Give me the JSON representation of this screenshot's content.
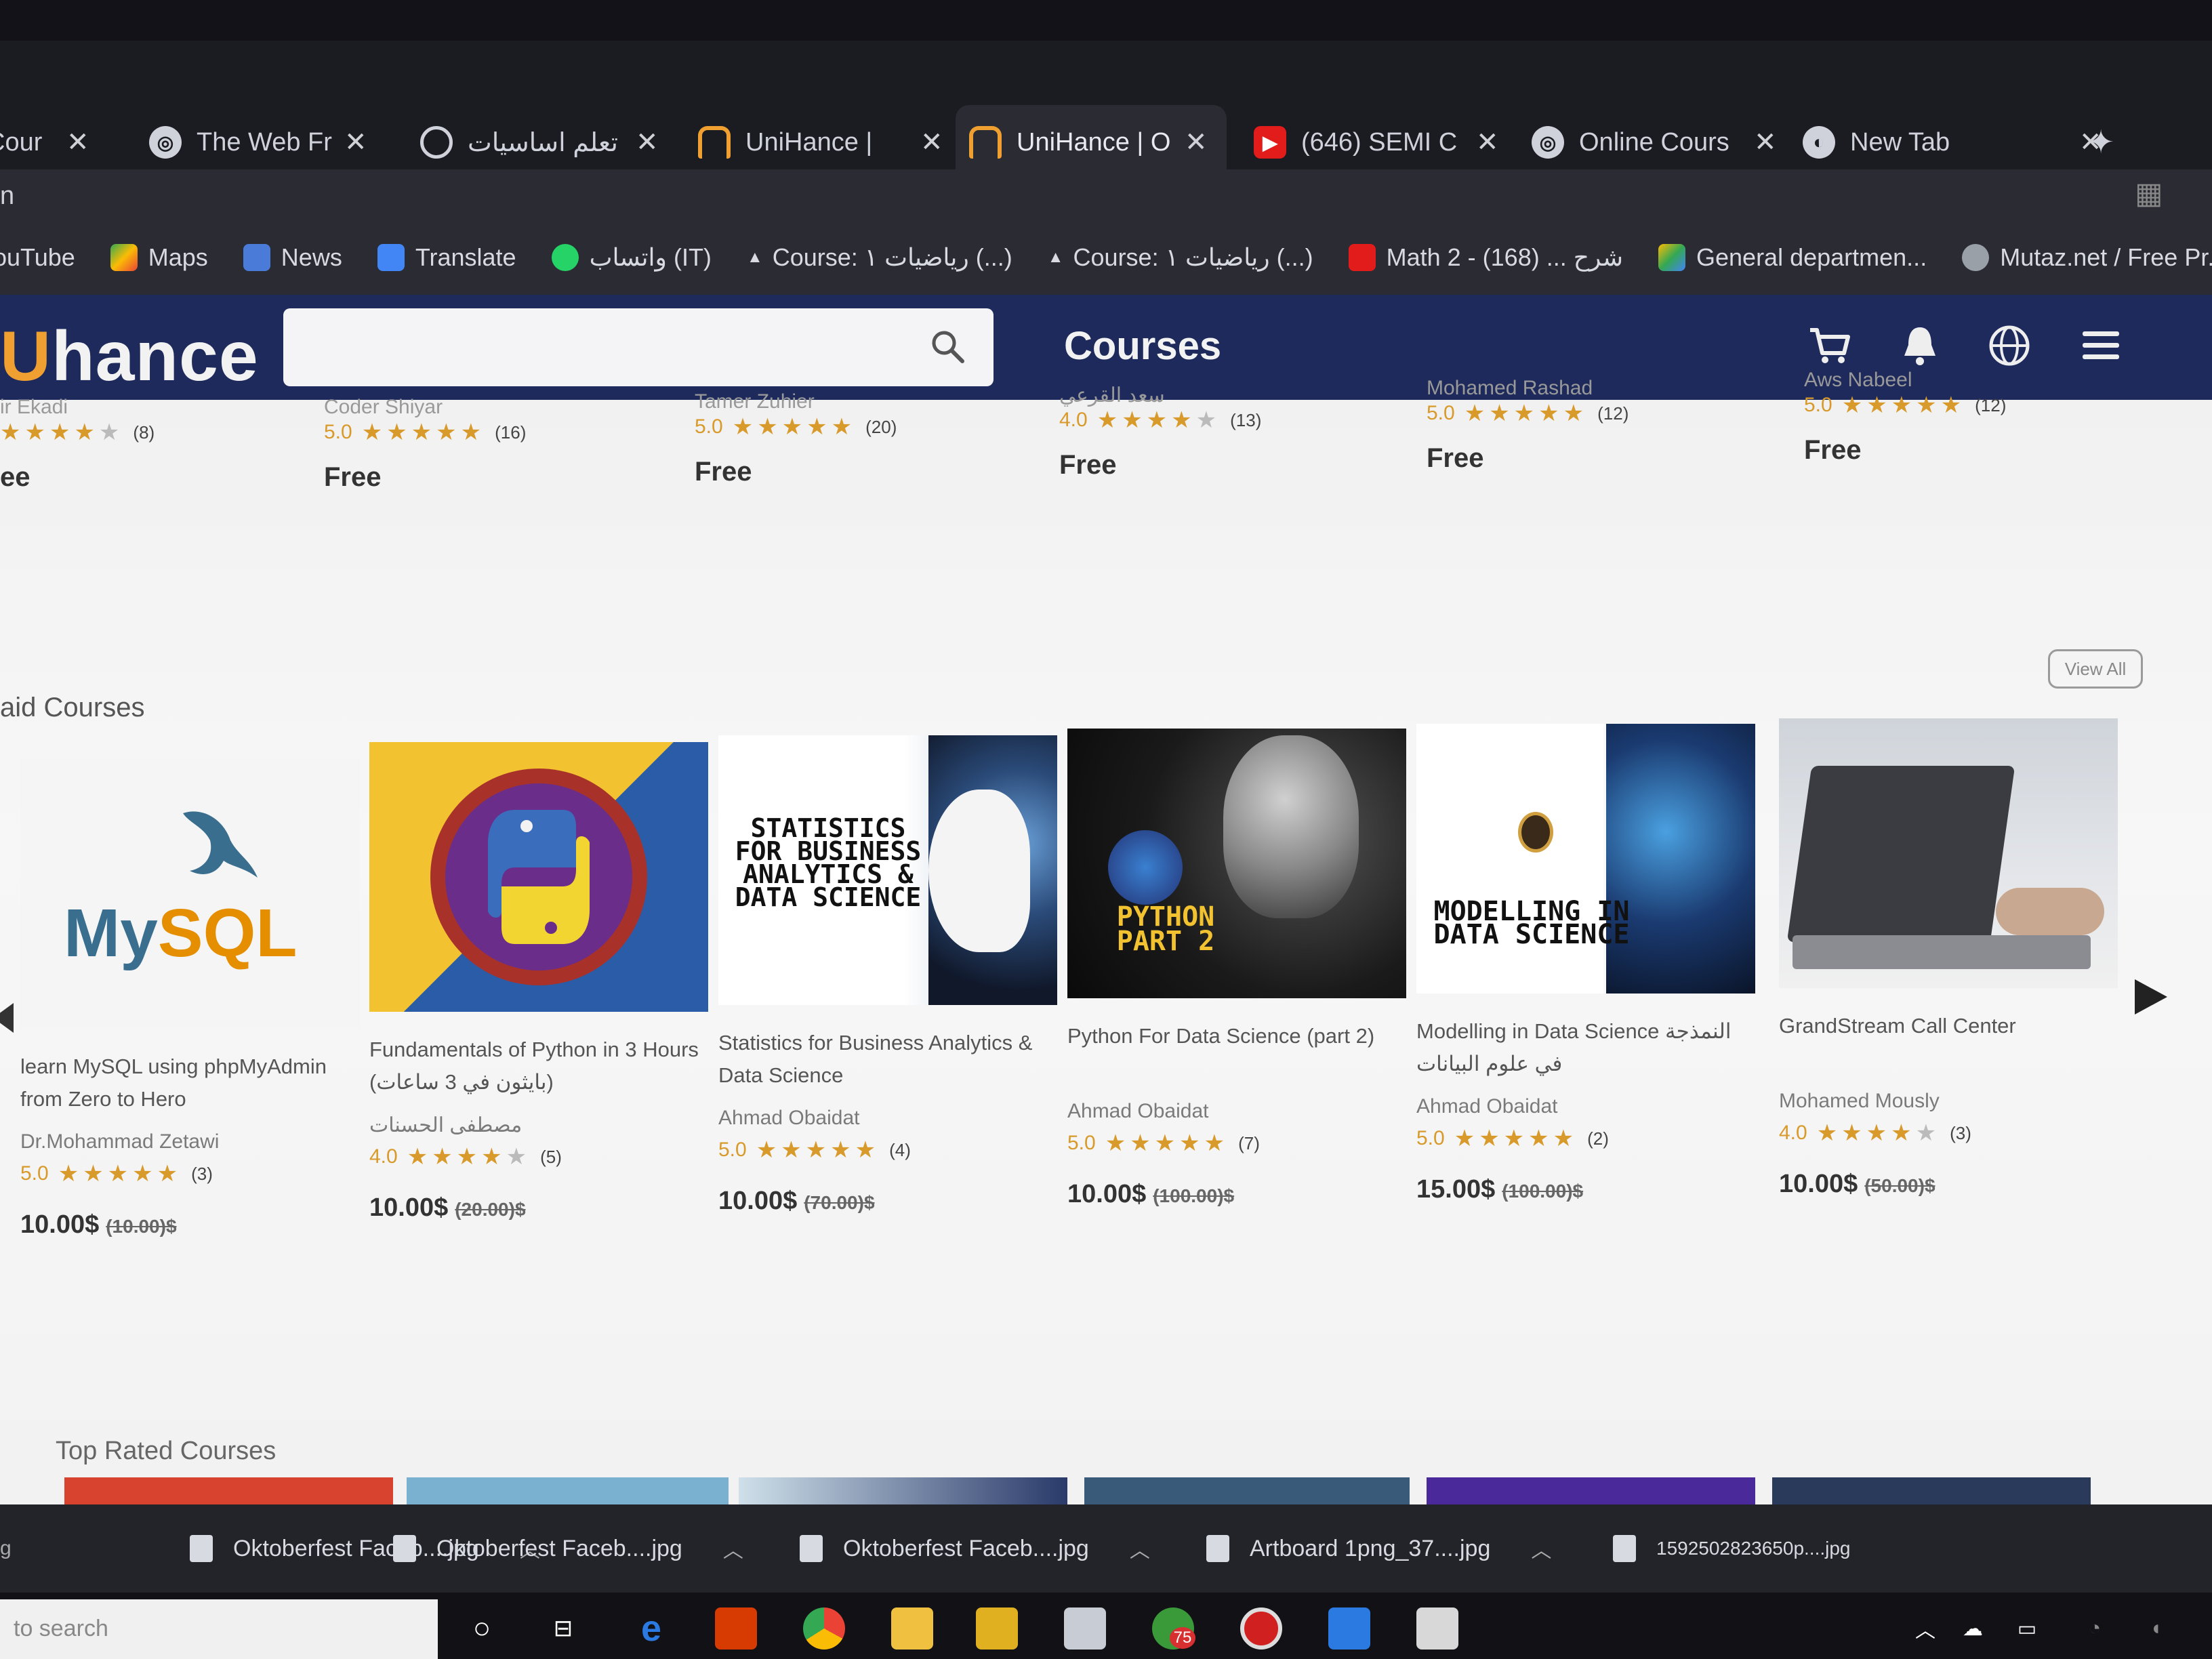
{
  "tabs": [
    {
      "title": "Cour",
      "icon": "unihance-icon"
    },
    {
      "title": "The Web Fro",
      "icon": "site-icon"
    },
    {
      "title": "تعلم اساسيات",
      "icon": "globe-icon"
    },
    {
      "title": "UniHance |",
      "icon": "unihance-icon"
    },
    {
      "title": "UniHance | O",
      "icon": "unihance-icon",
      "active": true
    },
    {
      "title": "(646) SEMI C",
      "icon": "youtube-icon"
    },
    {
      "title": "Online Cours",
      "icon": "site-icon"
    },
    {
      "title": "New Tab",
      "icon": "chrome-icon"
    }
  ],
  "address": {
    "text": "n"
  },
  "bookmarks": [
    {
      "label": "ouTube"
    },
    {
      "label": "Maps"
    },
    {
      "label": "News"
    },
    {
      "label": "Translate"
    },
    {
      "label": "واتساب (IT)"
    },
    {
      "label": "Course: رياضيات ١ (...)"
    },
    {
      "label": "Course: رياضيات ١ (...)"
    },
    {
      "label": "Math 2 - شرح ... (168)"
    },
    {
      "label": "General departmen..."
    },
    {
      "label": "Mutaz.net / Free Pr..."
    }
  ],
  "header": {
    "logo": "hance",
    "logo_prefix": "U",
    "nav_courses": "Courses",
    "search_placeholder": ""
  },
  "free_courses": [
    {
      "author": "ir Ekadi",
      "rating": "",
      "stars": 4,
      "count": "(8)",
      "price": "ee"
    },
    {
      "author": "Coder Shiyar",
      "rating": "5.0",
      "stars": 5,
      "count": "(16)",
      "price": "Free"
    },
    {
      "author": "Tamer Zuhier",
      "rating": "5.0",
      "stars": 5,
      "count": "(20)",
      "price": "Free"
    },
    {
      "author": "سعد القرعي",
      "rating": "4.0",
      "stars": 4,
      "count": "(13)",
      "price": "Free"
    },
    {
      "author": "Mohamed Rashad",
      "rating": "5.0",
      "stars": 5,
      "count": "(12)",
      "price": "Free"
    },
    {
      "author": "Aws Nabeel",
      "rating": "5.0",
      "stars": 5,
      "count": "(12)",
      "price": "Free"
    }
  ],
  "paid_section": {
    "title": "aid Courses",
    "view_all": "View All"
  },
  "paid_courses": [
    {
      "title": "learn MySQL using phpMyAdmin from Zero to Hero",
      "author": "Dr.Mohammad Zetawi",
      "rating": "5.0",
      "stars": 5,
      "count": "(3)",
      "price": "10.00$",
      "old_price": "(10.00)$",
      "thumb_text": "MySQL"
    },
    {
      "title": "Fundamentals of Python in 3 Hours (بايثون في 3 ساعات)",
      "author": "مصطفى الحسنات",
      "rating": "4.0",
      "stars": 4,
      "count": "(5)",
      "price": "10.00$",
      "old_price": "(20.00)$",
      "thumb_text": ""
    },
    {
      "title": "Statistics for Business Analytics & Data Science",
      "author": "Ahmad Obaidat",
      "rating": "5.0",
      "stars": 5,
      "count": "(4)",
      "price": "10.00$",
      "old_price": "(70.00)$",
      "thumb_text": "STATISTICS FOR BUSINESS ANALYTICS & DATA SCIENCE"
    },
    {
      "title": "Python For Data Science (part 2)",
      "author": "Ahmad Obaidat",
      "rating": "5.0",
      "stars": 5,
      "count": "(7)",
      "price": "10.00$",
      "old_price": "(100.00)$",
      "thumb_text": "PYTHON PART 2"
    },
    {
      "title": "Modelling in Data Science النمذجة في علوم البيانات",
      "author": "Ahmad Obaidat",
      "rating": "5.0",
      "stars": 5,
      "count": "(2)",
      "price": "15.00$",
      "old_price": "(100.00)$",
      "thumb_text": "MODELLING IN DATA SCIENCE"
    },
    {
      "title": "GrandStream Call Center",
      "author": "Mohamed Mously",
      "rating": "4.0",
      "stars": 4,
      "count": "(3)",
      "price": "10.00$",
      "old_price": "(50.00)$",
      "thumb_text": ""
    }
  ],
  "top_rated": {
    "title": "Top Rated Courses"
  },
  "downloads": [
    {
      "name": "Oktoberfest Faceb....jpg"
    },
    {
      "name": "Oktoberfest Faceb....jpg"
    },
    {
      "name": "Oktoberfest Faceb....jpg"
    },
    {
      "name": "Artboard 1png_37....jpg"
    },
    {
      "name": "1592502823650p....jpg"
    }
  ],
  "taskbar": {
    "search_placeholder": "to search",
    "badge": "75"
  }
}
